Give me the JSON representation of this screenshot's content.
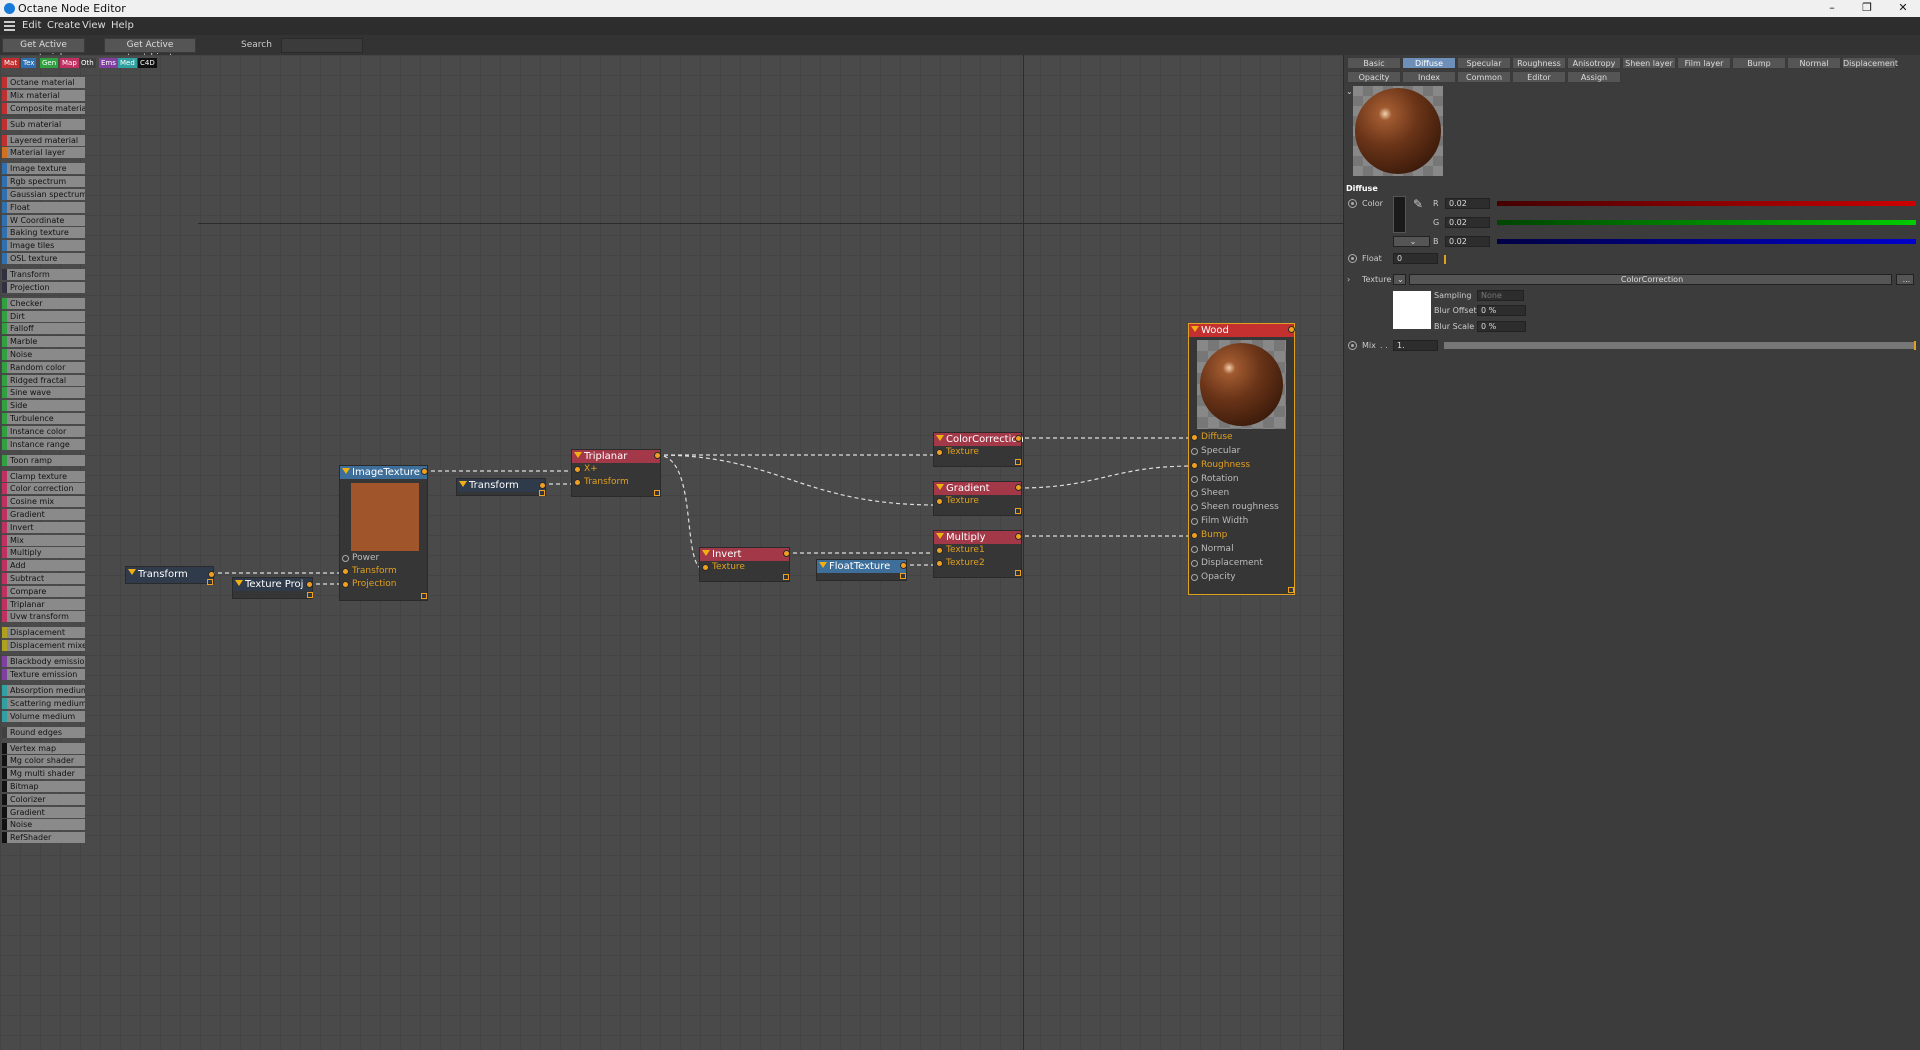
{
  "window": {
    "title": "Octane Node Editor",
    "minimize": "–",
    "restore": "❐",
    "close": "✕"
  },
  "menu": [
    "Edit",
    "Create",
    "View",
    "Help"
  ],
  "toolbar": {
    "get_active_material": "Get Active material",
    "get_active_tag": "Get Active tag/object",
    "search_label": "Search",
    "search_value": ""
  },
  "category_tabs": [
    {
      "label": "Mat",
      "color": "#c03030"
    },
    {
      "label": "Tex",
      "color": "#3070b0"
    },
    {
      "label": "Gen",
      "color": "#30a040"
    },
    {
      "label": "Map",
      "color": "#c03060"
    },
    {
      "label": "Oth",
      "color": "#404040"
    },
    {
      "label": "Ems",
      "color": "#8040a0"
    },
    {
      "label": "Med",
      "color": "#30a0a0"
    },
    {
      "label": "C4D",
      "color": "#111111"
    }
  ],
  "palette": [
    {
      "label": "Octane material",
      "color": "#c03030"
    },
    {
      "label": "Mix material",
      "color": "#c03030"
    },
    {
      "label": "Composite material",
      "color": "#c03030"
    },
    {
      "label": "Sub material",
      "color": "#c03030"
    },
    {
      "label": "Layered material",
      "color": "#c03030"
    },
    {
      "label": "Material layer",
      "color": "#d07020"
    },
    {
      "label": "Image texture",
      "color": "#3070b0"
    },
    {
      "label": "Rgb spectrum",
      "color": "#3070b0"
    },
    {
      "label": "Gaussian spectrum",
      "color": "#3070b0"
    },
    {
      "label": "Float",
      "color": "#3070b0"
    },
    {
      "label": "W Coordinate",
      "color": "#3070b0"
    },
    {
      "label": "Baking texture",
      "color": "#3070b0"
    },
    {
      "label": "Image tiles",
      "color": "#3070b0"
    },
    {
      "label": "OSL texture",
      "color": "#3070b0"
    },
    {
      "label": "Transform",
      "color": "#303040"
    },
    {
      "label": "Projection",
      "color": "#303040"
    },
    {
      "label": "Checker",
      "color": "#30a040"
    },
    {
      "label": "Dirt",
      "color": "#30a040"
    },
    {
      "label": "Falloff",
      "color": "#30a040"
    },
    {
      "label": "Marble",
      "color": "#30a040"
    },
    {
      "label": "Noise",
      "color": "#30a040"
    },
    {
      "label": "Random color",
      "color": "#30a040"
    },
    {
      "label": "Ridged fractal",
      "color": "#30a040"
    },
    {
      "label": "Sine wave",
      "color": "#30a040"
    },
    {
      "label": "Side",
      "color": "#30a040"
    },
    {
      "label": "Turbulence",
      "color": "#30a040"
    },
    {
      "label": "Instance color",
      "color": "#30a040"
    },
    {
      "label": "Instance range",
      "color": "#30a040"
    },
    {
      "label": "Toon ramp",
      "color": "#30a040"
    },
    {
      "label": "Clamp texture",
      "color": "#c03060"
    },
    {
      "label": "Color correction",
      "color": "#c03060"
    },
    {
      "label": "Cosine mix",
      "color": "#c03060"
    },
    {
      "label": "Gradient",
      "color": "#c03060"
    },
    {
      "label": "Invert",
      "color": "#c03060"
    },
    {
      "label": "Mix",
      "color": "#c03060"
    },
    {
      "label": "Multiply",
      "color": "#c03060"
    },
    {
      "label": "Add",
      "color": "#c03060"
    },
    {
      "label": "Subtract",
      "color": "#c03060"
    },
    {
      "label": "Compare",
      "color": "#c03060"
    },
    {
      "label": "Triplanar",
      "color": "#c03060"
    },
    {
      "label": "Uvw transform",
      "color": "#c03060"
    },
    {
      "label": "Displacement",
      "color": "#b0a020"
    },
    {
      "label": "Displacement mixer",
      "color": "#b0a020"
    },
    {
      "label": "Blackbody emission",
      "color": "#8040a0"
    },
    {
      "label": "Texture emission",
      "color": "#8040a0"
    },
    {
      "label": "Absorption medium",
      "color": "#30a0a0"
    },
    {
      "label": "Scattering medium",
      "color": "#30a0a0"
    },
    {
      "label": "Volume medium",
      "color": "#30a0a0"
    },
    {
      "label": "Round edges",
      "color": "#404040"
    },
    {
      "label": "Vertex map",
      "color": "#111111"
    },
    {
      "label": "Mg color shader",
      "color": "#111111"
    },
    {
      "label": "Mg multi shader",
      "color": "#111111"
    },
    {
      "label": "Bitmap",
      "color": "#111111"
    },
    {
      "label": "Colorizer",
      "color": "#111111"
    },
    {
      "label": "Gradient",
      "color": "#111111"
    },
    {
      "label": "Noise",
      "color": "#111111"
    },
    {
      "label": "RefShader",
      "color": "#111111"
    }
  ],
  "nodes": {
    "transform_left": {
      "title": "Transform"
    },
    "texture_proj": {
      "title": "Texture Proj"
    },
    "image_texture": {
      "title": "ImageTexture",
      "inputs": [
        "Power",
        "Transform",
        "Projection"
      ],
      "swatch": "#a0552a"
    },
    "transform_mid": {
      "title": "Transform"
    },
    "triplanar": {
      "title": "Triplanar",
      "inputs": [
        "X+",
        "Transform"
      ]
    },
    "color_correction": {
      "title": "ColorCorrection",
      "inputs": [
        "Texture"
      ]
    },
    "gradient": {
      "title": "Gradient",
      "inputs": [
        "Texture"
      ]
    },
    "invert": {
      "title": "Invert",
      "inputs": [
        "Texture"
      ]
    },
    "float_texture": {
      "title": "FloatTexture"
    },
    "multiply": {
      "title": "Multiply",
      "inputs": [
        "Texture1",
        "Texture2"
      ]
    },
    "wood": {
      "title": "Wood",
      "inputs": [
        "Diffuse",
        "Specular",
        "Roughness",
        "Rotation",
        "Sheen",
        "Sheen roughness",
        "Film Width",
        "Bump",
        "Normal",
        "Displacement",
        "Opacity"
      ]
    }
  },
  "panel": {
    "tabs_row1": [
      "Basic",
      "Diffuse",
      "Specular",
      "Roughness",
      "Anisotropy",
      "Sheen layer",
      "Film layer",
      "Bump",
      "Normal",
      "Displacement"
    ],
    "tabs_row2": [
      "Opacity",
      "Index",
      "Common",
      "Editor",
      "Assign"
    ],
    "active_tab": "Diffuse",
    "section_title": "Diffuse",
    "color_label": "Color",
    "r_label": "R",
    "r_value": "0.02",
    "g_label": "G",
    "g_value": "0.02",
    "b_label": "B",
    "b_value": "0.02",
    "color_mode": "⌄",
    "float_label": "Float",
    "float_value": "0",
    "texture_label": "Texture",
    "texture_value": "ColorCorrection",
    "texture_more": "...",
    "sampling_label": "Sampling",
    "sampling_value": "None",
    "blur_offset_label": "Blur Offset",
    "blur_offset_value": "0 %",
    "blur_scale_label": "Blur Scale",
    "blur_scale_value": "0 %",
    "mix_label": "Mix",
    "mix_dots": ". .",
    "mix_value": "1."
  }
}
